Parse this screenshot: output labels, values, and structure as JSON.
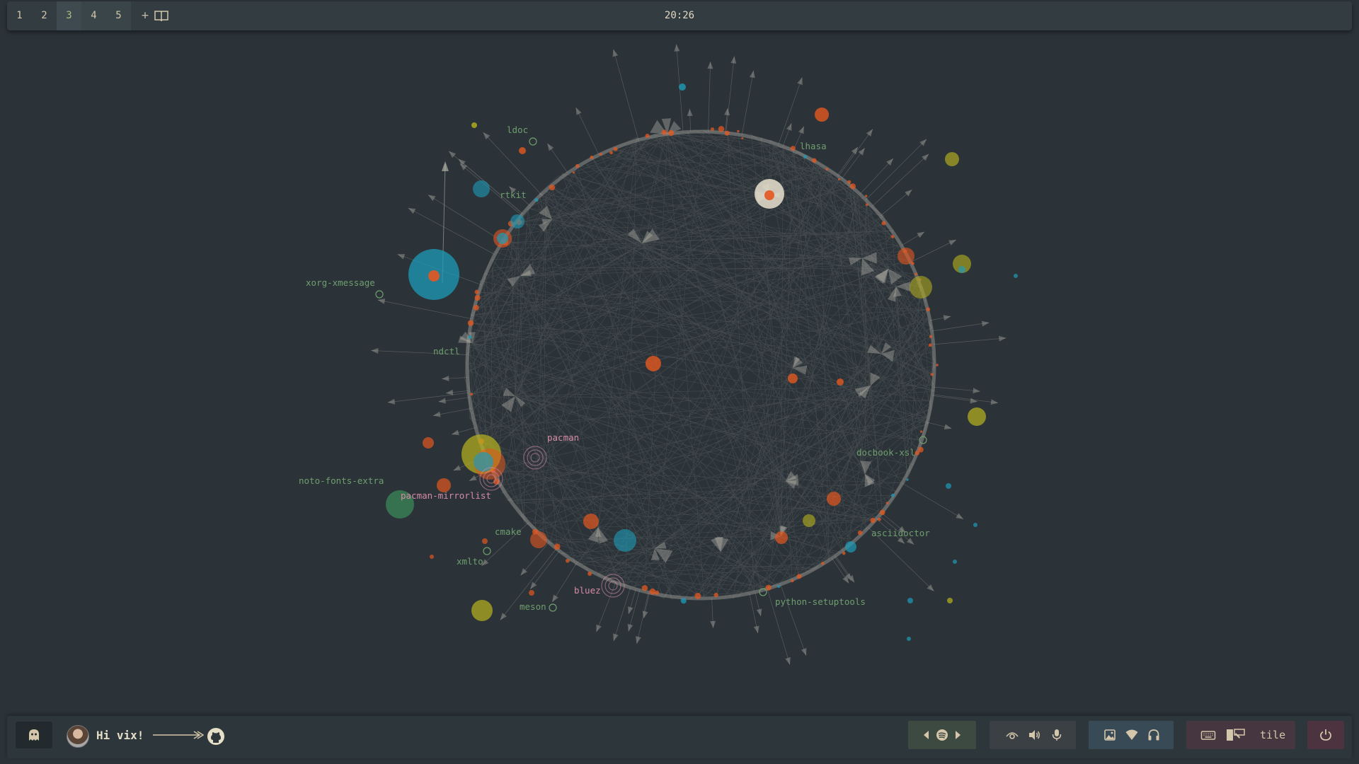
{
  "topbar": {
    "workspaces": [
      "1",
      "2",
      "3",
      "4",
      "5"
    ],
    "add_label": "+",
    "clock": "20:26"
  },
  "graph": {
    "labels": [
      "ldoc",
      "lhasa",
      "rtkit",
      "xorg-xmessage",
      "ndctl",
      "pacman",
      "noto-fonts-extra",
      "pacman-mirrorlist",
      "docbook-xsl",
      "cmake",
      "xmlto",
      "asciidoctor",
      "bluez",
      "meson",
      "python-setuptools"
    ],
    "colors": {
      "orange": "#e4571f",
      "blue": "#1e9bb8",
      "yellow": "#b8b21d",
      "green": "#3d9d5f",
      "edge": "#c9c4b8",
      "label_green": "#6f9e6e",
      "label_pink": "#d68ba5"
    }
  },
  "bottombar": {
    "greeting": "Hi vix!",
    "layout_name": "tile",
    "icons": {
      "launcher": "ghost-icon",
      "profile": "avatar",
      "repo": "github-icon",
      "media": [
        "prev-icon",
        "spotify-icon",
        "next-icon"
      ],
      "audio": [
        "eye-icon",
        "volume-icon",
        "microphone-icon"
      ],
      "network": [
        "image-icon",
        "wifi-icon",
        "headphones-icon"
      ],
      "layout": [
        "keyboard-icon",
        "tile-layout-icon"
      ],
      "system": "power-icon"
    }
  }
}
